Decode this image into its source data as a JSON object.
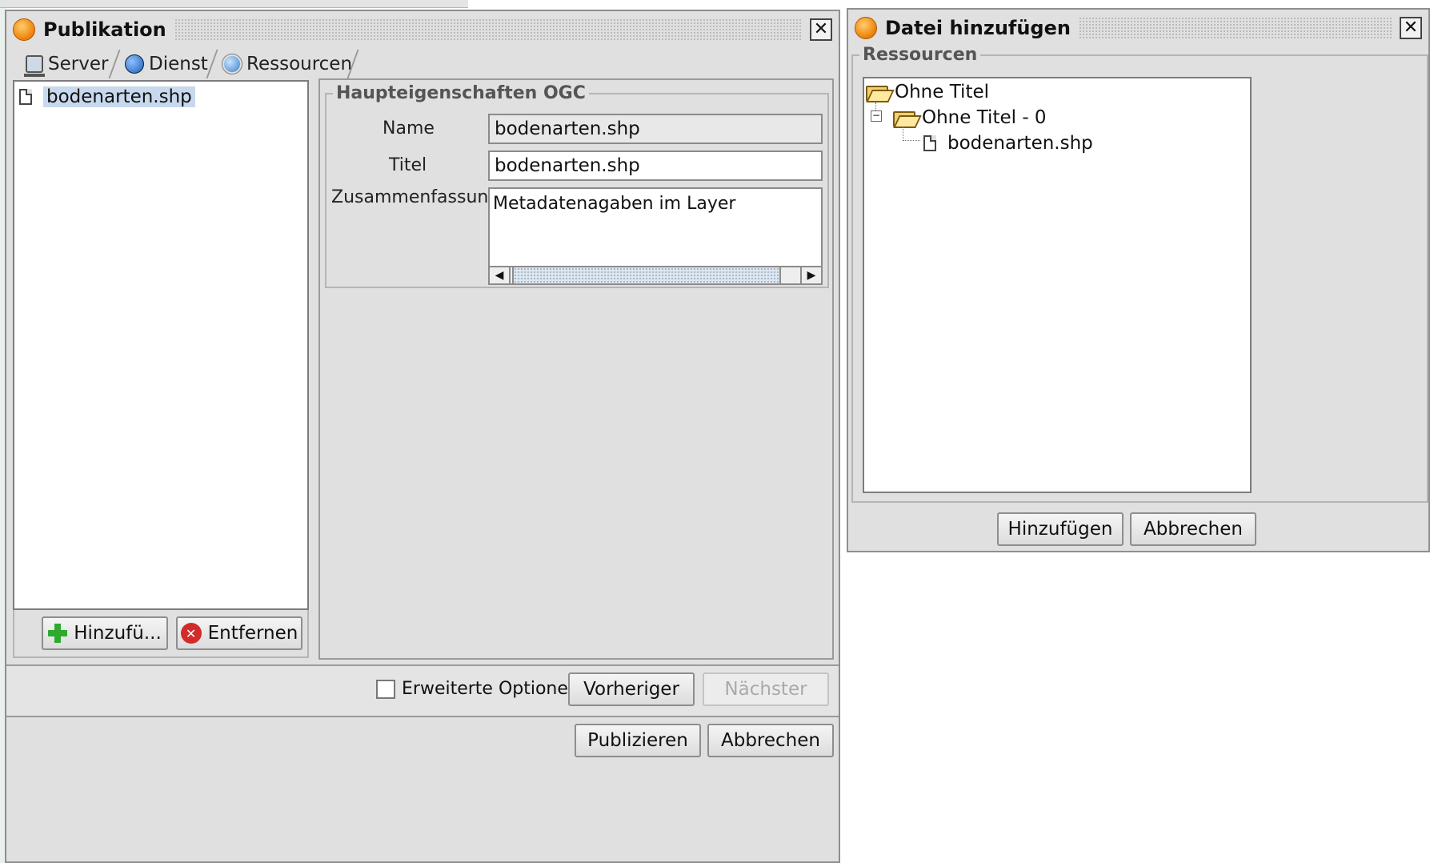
{
  "publikation": {
    "title": "Publikation",
    "close": "⊠",
    "tabs": [
      {
        "label": "Server"
      },
      {
        "label": "Dienst"
      },
      {
        "label": "Ressourcen"
      }
    ],
    "resource_list": [
      "bodenarten.shp"
    ],
    "add_button": "Hinzufü...",
    "remove_button": "Entfernen",
    "group_title": "Haupteigenschaften OGC",
    "fields": {
      "name_label": "Name",
      "name_value": "bodenarten.shp",
      "title_label": "Titel",
      "title_value": "bodenarten.shp",
      "summary_label": "Zusammenfassung",
      "summary_value": "Metadatenagaben im Layer"
    },
    "advanced_options": "Erweiterte Optionen",
    "advanced_checked": false,
    "previous": "Vorheriger",
    "next": "Nächster",
    "publish": "Publizieren",
    "cancel": "Abbrechen"
  },
  "datei_dialog": {
    "title": "Datei hinzufügen",
    "close": "⊠",
    "group_title": "Ressourcen",
    "tree": {
      "root": "Ohne Titel",
      "child": "Ohne Titel - 0",
      "leaf": "bodenarten.shp"
    },
    "add": "Hinzufügen",
    "cancel": "Abbrechen"
  },
  "colors": {
    "selection": "#c8d9ee",
    "window_bg": "#e0e0e0",
    "add_icon": "#2eaa2e",
    "remove_icon": "#d22b2b"
  },
  "icons": {
    "server": "server-icon",
    "dienst": "globe-icon",
    "ressourcen": "layers-globe-icon"
  }
}
